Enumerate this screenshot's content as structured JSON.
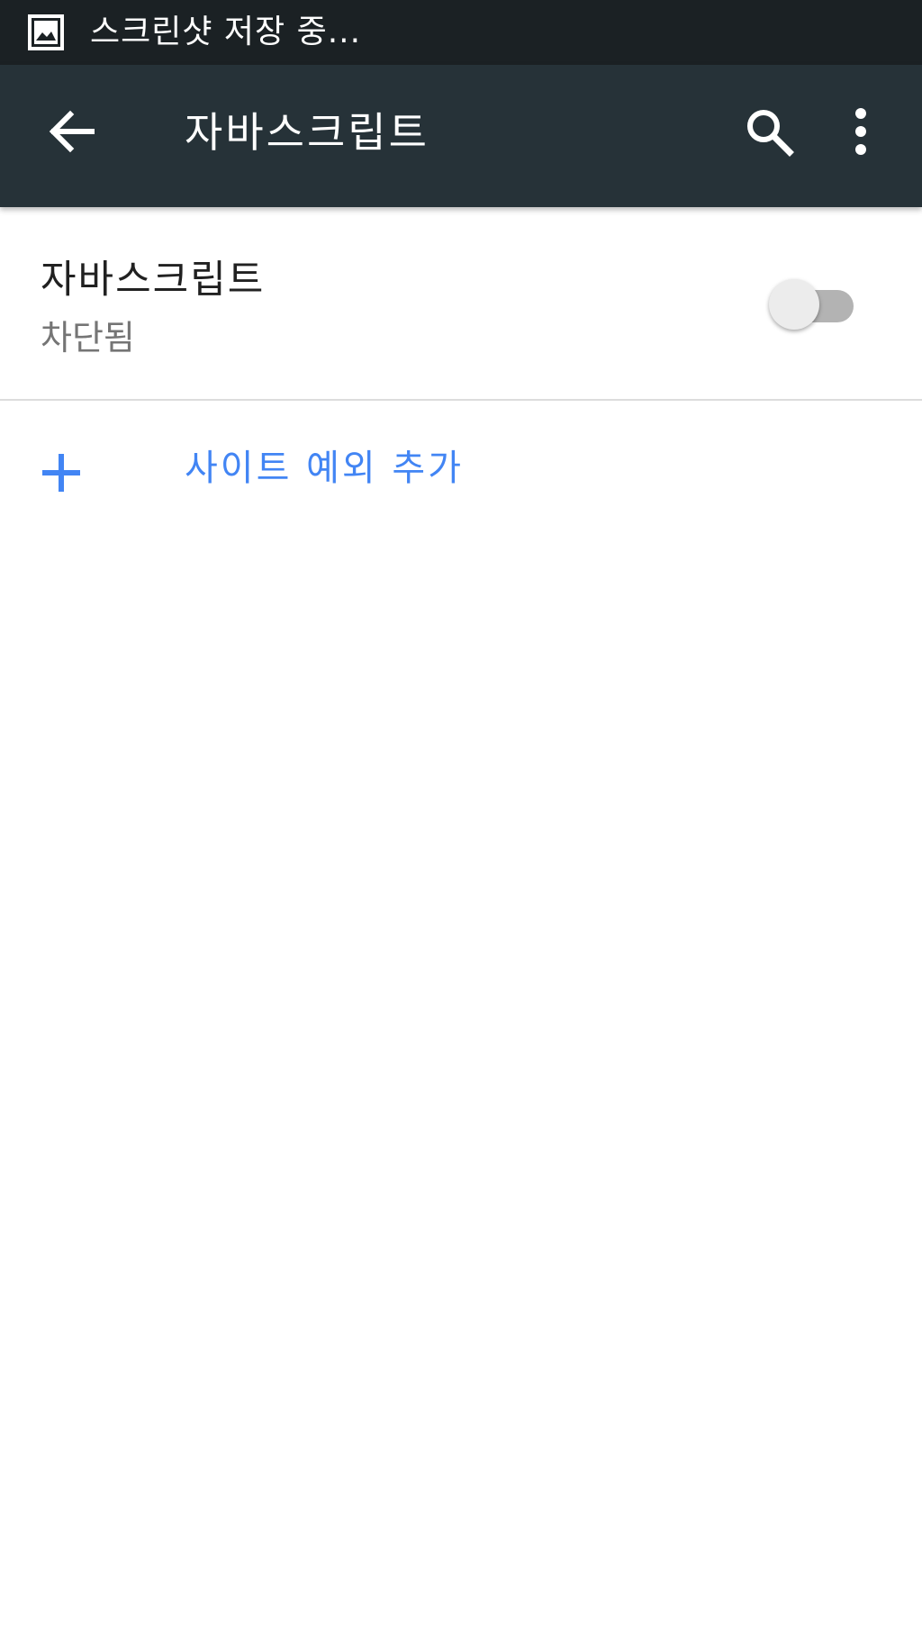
{
  "status_bar": {
    "icon": "image-icon",
    "notification_text": "스크린샷 저장 중..."
  },
  "app_bar": {
    "back_icon": "arrow-back-icon",
    "title": "자바스크립트",
    "search_icon": "search-icon",
    "more_icon": "more-vert-icon"
  },
  "setting": {
    "title": "자바스크립트",
    "summary": "차단됨",
    "toggle_state": "off"
  },
  "add_exception": {
    "icon": "plus-icon",
    "label": "사이트 예외 추가"
  },
  "colors": {
    "status_bar": "#1b2124",
    "app_bar": "#263238",
    "accent": "#4285f4",
    "toggle_track": "#b3b3b3",
    "toggle_thumb": "#ececec"
  }
}
